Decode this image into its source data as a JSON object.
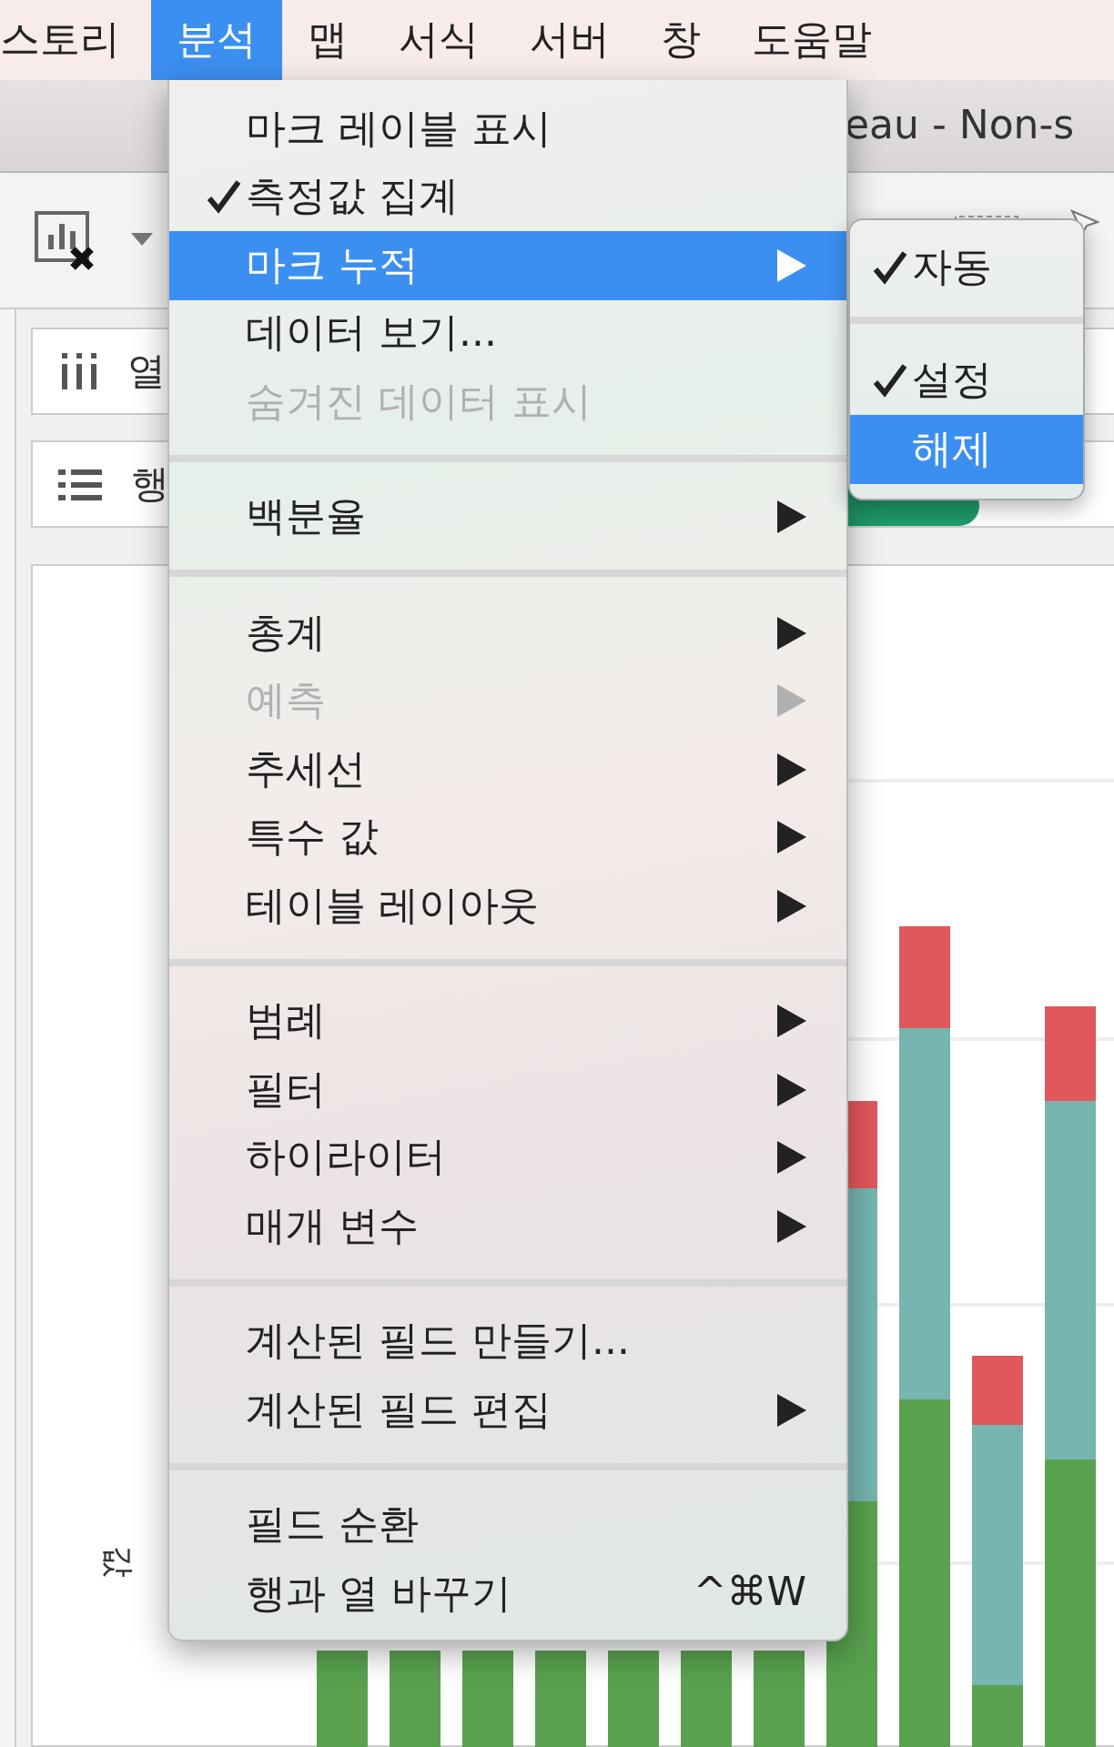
{
  "menu_bar": {
    "items": [
      {
        "label": "스토리",
        "selected": false
      },
      {
        "label": "분석",
        "selected": true
      },
      {
        "label": "맵",
        "selected": false
      },
      {
        "label": "서식",
        "selected": false
      },
      {
        "label": "서버",
        "selected": false
      },
      {
        "label": "창",
        "selected": false
      },
      {
        "label": "도움말",
        "selected": false
      }
    ]
  },
  "window": {
    "title": "eau - Non-s"
  },
  "shelves": [
    {
      "label": "열",
      "kind": "columns"
    },
    {
      "label": "행",
      "kind": "rows"
    }
  ],
  "chart": {
    "axis_label": "값"
  },
  "menu": {
    "sections": [
      [
        {
          "label": "마크 레이블 표시",
          "checked": false,
          "disabled": false,
          "submenu": false,
          "selected": false
        },
        {
          "label": "측정값 집계",
          "checked": true,
          "disabled": false,
          "submenu": false,
          "selected": false
        },
        {
          "label": "마크 누적",
          "checked": false,
          "disabled": false,
          "submenu": true,
          "selected": true
        },
        {
          "label": "데이터 보기...",
          "checked": false,
          "disabled": false,
          "submenu": false,
          "selected": false
        },
        {
          "label": "숨겨진 데이터 표시",
          "checked": false,
          "disabled": true,
          "submenu": false,
          "selected": false
        }
      ],
      [
        {
          "label": "백분율",
          "checked": false,
          "disabled": false,
          "submenu": true,
          "selected": false
        }
      ],
      [
        {
          "label": "총계",
          "checked": false,
          "disabled": false,
          "submenu": true,
          "selected": false
        },
        {
          "label": "예측",
          "checked": false,
          "disabled": true,
          "submenu": true,
          "selected": false
        },
        {
          "label": "추세선",
          "checked": false,
          "disabled": false,
          "submenu": true,
          "selected": false
        },
        {
          "label": "특수 값",
          "checked": false,
          "disabled": false,
          "submenu": true,
          "selected": false
        },
        {
          "label": "테이블 레이아웃",
          "checked": false,
          "disabled": false,
          "submenu": true,
          "selected": false
        }
      ],
      [
        {
          "label": "범례",
          "checked": false,
          "disabled": false,
          "submenu": true,
          "selected": false
        },
        {
          "label": "필터",
          "checked": false,
          "disabled": false,
          "submenu": true,
          "selected": false
        },
        {
          "label": "하이라이터",
          "checked": false,
          "disabled": false,
          "submenu": true,
          "selected": false
        },
        {
          "label": "매개 변수",
          "checked": false,
          "disabled": false,
          "submenu": true,
          "selected": false
        }
      ],
      [
        {
          "label": "계산된 필드 만들기...",
          "checked": false,
          "disabled": false,
          "submenu": false,
          "selected": false
        },
        {
          "label": "계산된 필드 편집",
          "checked": false,
          "disabled": false,
          "submenu": true,
          "selected": false
        }
      ],
      [
        {
          "label": "필드 순환",
          "checked": false,
          "disabled": false,
          "submenu": false,
          "selected": false
        },
        {
          "label": "행과 열 바꾸기",
          "checked": false,
          "disabled": false,
          "submenu": false,
          "selected": false,
          "shortcut": "^⌘W"
        }
      ]
    ]
  },
  "submenu": {
    "sections": [
      [
        {
          "label": "자동",
          "checked": true,
          "selected": false
        }
      ],
      [
        {
          "label": "설정",
          "checked": true,
          "selected": false
        },
        {
          "label": "해제",
          "checked": false,
          "selected": true
        }
      ]
    ]
  }
}
